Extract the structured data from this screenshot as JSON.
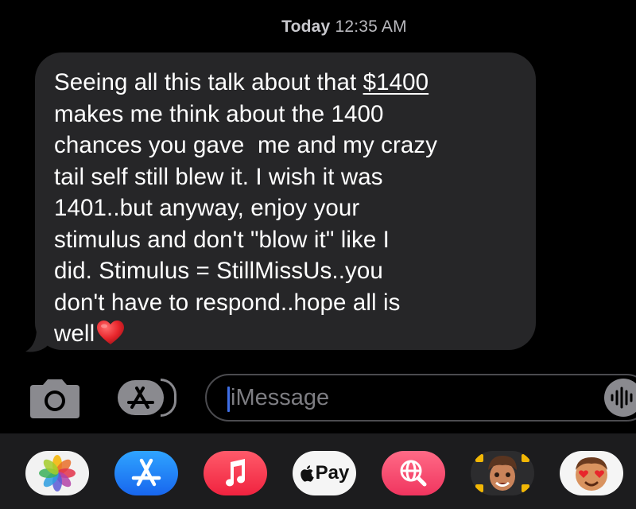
{
  "header": {
    "timestamp_day": "Today",
    "timestamp_time": "12:35 AM"
  },
  "message": {
    "lines": [
      "makes me think about the 1400",
      "chances you gave  me and my crazy",
      "tail self still blew it. I wish it was",
      "1401..but anyway, enjoy your",
      "stimulus and don't \"blow it\" like I",
      "did. Stimulus = StillMissUs..you",
      "don't have to respond..hope all is"
    ],
    "first_line_prefix": "Seeing all this talk about that ",
    "first_line_link": "$1400",
    "last_line": "well",
    "emoji": "red-heart"
  },
  "input_bar": {
    "placeholder": "iMessage",
    "camera_icon": "camera-icon",
    "apps_icon": "app-store-icon",
    "audio_icon": "waveform-icon"
  },
  "app_drawer": {
    "apps": [
      {
        "name": "Photos",
        "icon": "photos-icon"
      },
      {
        "name": "App Store",
        "icon": "app-store-icon"
      },
      {
        "name": "Music",
        "icon": "music-icon"
      },
      {
        "name": "Apple Pay",
        "icon": "apple-pay-icon",
        "label": "Pay"
      },
      {
        "name": "Images",
        "icon": "globe-search-icon"
      },
      {
        "name": "Memoji Stickers",
        "icon": "memoji-icon"
      },
      {
        "name": "Animoji",
        "icon": "animoji-icon"
      }
    ]
  },
  "colors": {
    "background": "#000000",
    "bubble": "#262628",
    "caret": "#3f6fe6",
    "heart": "#e8262c"
  }
}
